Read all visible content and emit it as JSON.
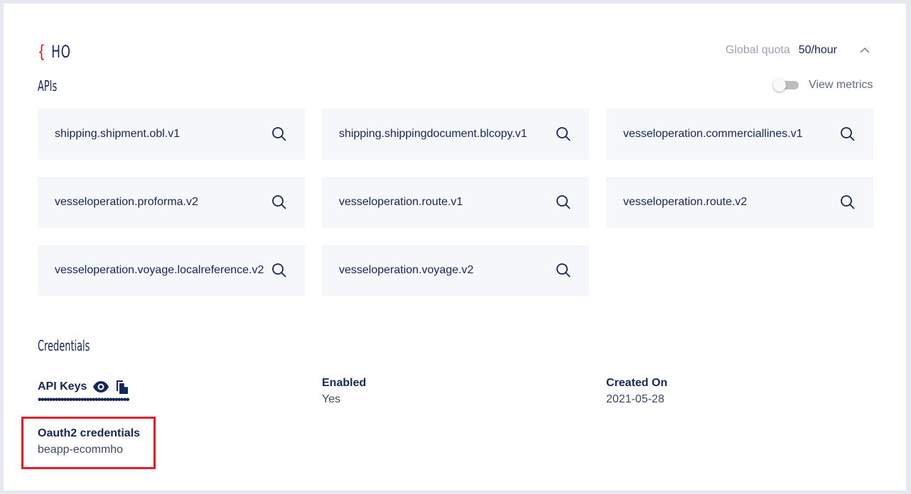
{
  "header": {
    "brace": "{",
    "title": "HO",
    "quota_label": "Global quota",
    "quota_value": "50/hour"
  },
  "apis": {
    "title": "APIs",
    "view_metrics_label": "View metrics",
    "view_metrics_on": false,
    "items": [
      {
        "name": "shipping.shipment.obl.v1"
      },
      {
        "name": "shipping.shippingdocument.blcopy.v1"
      },
      {
        "name": "vesseloperation.commerciallines.v1"
      },
      {
        "name": "vesseloperation.proforma.v2"
      },
      {
        "name": "vesseloperation.route.v1"
      },
      {
        "name": "vesseloperation.route.v2"
      },
      {
        "name": "vesseloperation.voyage.localreference.v2"
      },
      {
        "name": "vesseloperation.voyage.v2"
      }
    ]
  },
  "credentials": {
    "title": "Credentials",
    "api_keys_label": "API Keys",
    "api_keys_masked": "••••••••••••••••••••••••••••••••",
    "enabled_label": "Enabled",
    "enabled_value": "Yes",
    "created_label": "Created On",
    "created_value": "2021-05-28",
    "oauth_label": "Oauth2 credentials",
    "oauth_value": "beapp-ecommho"
  },
  "colors": {
    "accent_red": "#d2131c",
    "text_navy": "#14265a",
    "tile_bg": "#f5f7fa",
    "highlight_red": "#e1202b"
  },
  "icons": [
    "chevron-up-icon",
    "search-icon",
    "eye-icon",
    "copy-icon"
  ]
}
